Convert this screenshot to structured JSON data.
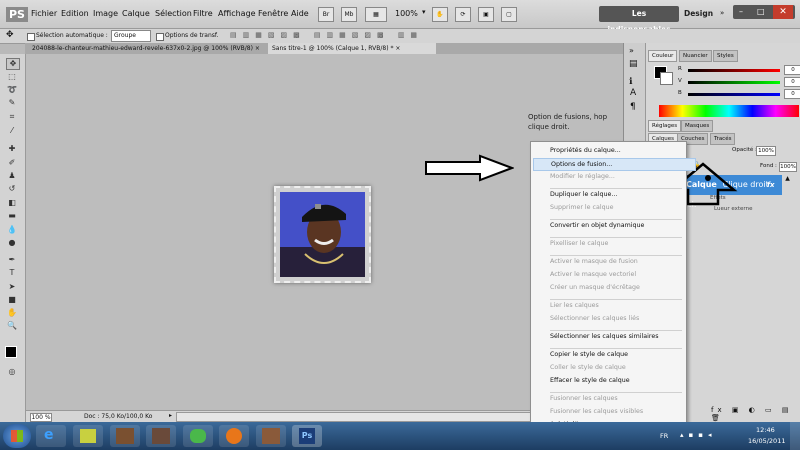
{
  "app": {
    "logo": "PS"
  },
  "menu": [
    "Fichier",
    "Edition",
    "Image",
    "Calque",
    "Sélection",
    "Filtre",
    "Affichage",
    "Fenêtre",
    "Aide"
  ],
  "menubar_tools": {
    "br": "Br",
    "mb": "Mb",
    "zoom": "100%"
  },
  "workspace": {
    "active": "Les indispensables",
    "other": "Design"
  },
  "options_bar": {
    "auto_select_label": "Sélection automatique :",
    "auto_select_value": "Groupe",
    "transform_label": "Options de transf."
  },
  "doc_tabs": [
    "204088-le-chanteur-mathieu-edward-revele-637x0-2.jpg @ 100% (RVB/8)",
    "Sans titre-1 @ 100% (Calque 1, RVB/8) *"
  ],
  "annotation": "Option de fusions, hop clique droit.",
  "status": {
    "zoom": "100 %",
    "doc": "Doc : 75,0 Ko/100,0 Ko"
  },
  "color_panel": {
    "tabs": [
      "Couleur",
      "Nuancier",
      "Styles"
    ],
    "channels": [
      {
        "label": "R",
        "value": "0",
        "color": "#d42020"
      },
      {
        "label": "V",
        "value": "0",
        "color": "#20b020"
      },
      {
        "label": "B",
        "value": "0",
        "color": "#2030d0"
      }
    ]
  },
  "adjust_panel": {
    "tabs": [
      "Réglages",
      "Masques"
    ]
  },
  "layers_panel": {
    "tabs": [
      "Calques",
      "Couches",
      "Tracés"
    ],
    "opacity_label": "Opacité :",
    "opacity_value": "100%",
    "fill_label": "Fond :",
    "fill_value": "100%",
    "layer_name": "Calque",
    "layer_note": "Clique droit ici.",
    "fx_label": "fx",
    "effects_label": "Effets",
    "effect_item": "Lueur externe"
  },
  "context_menu": [
    {
      "label": "Propriétés du calque...",
      "state": "normal"
    },
    {
      "label": "Options de fusion...",
      "state": "highlight"
    },
    {
      "label": "Modifier le réglage...",
      "state": "disabled"
    },
    {
      "sep": true
    },
    {
      "label": "Dupliquer le calque...",
      "state": "normal"
    },
    {
      "label": "Supprimer le calque",
      "state": "disabled"
    },
    {
      "sep": true
    },
    {
      "label": "Convertir en objet dynamique",
      "state": "normal"
    },
    {
      "sep": true
    },
    {
      "label": "Pixelliser le calque",
      "state": "disabled"
    },
    {
      "sep": true
    },
    {
      "label": "Activer le masque de fusion",
      "state": "disabled"
    },
    {
      "label": "Activer le masque vectoriel",
      "state": "disabled"
    },
    {
      "label": "Créer un masque d'écrêtage",
      "state": "disabled"
    },
    {
      "sep": true
    },
    {
      "label": "Lier les calques",
      "state": "disabled"
    },
    {
      "label": "Sélectionner les calques liés",
      "state": "disabled"
    },
    {
      "sep": true
    },
    {
      "label": "Sélectionner les calques similaires",
      "state": "normal"
    },
    {
      "sep": true
    },
    {
      "label": "Copier le style de calque",
      "state": "normal"
    },
    {
      "label": "Coller le style de calque",
      "state": "disabled"
    },
    {
      "label": "Effacer le style de calque",
      "state": "normal"
    },
    {
      "sep": true
    },
    {
      "label": "Fusionner les calques",
      "state": "disabled"
    },
    {
      "label": "Fusionner les calques visibles",
      "state": "disabled"
    },
    {
      "label": "Aplatir l'image",
      "state": "normal"
    }
  ],
  "taskbar": {
    "lang": "FR",
    "time": "12:46",
    "date": "16/05/2011",
    "ps_label": "Ps"
  }
}
